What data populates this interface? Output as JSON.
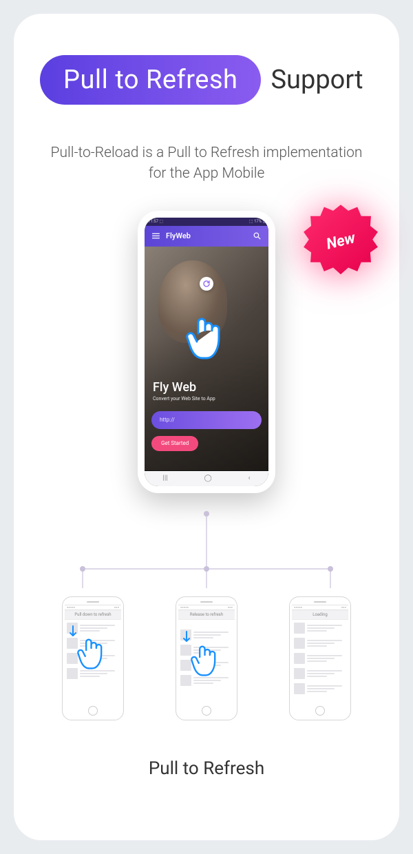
{
  "header": {
    "pill": "Pull to Refresh",
    "support": "Support"
  },
  "badge": {
    "label": "New"
  },
  "subtitle": "Pull-to-Reload is a Pull to Refresh implementation for the App Mobile",
  "main_phone": {
    "status_left": "11:57 ⬚",
    "status_right": "⬚ 17% ▯",
    "app_title": "FlyWeb",
    "hero_title": "Fly Web",
    "hero_sub": "Convert your Web Site to App",
    "url_placeholder": "http://",
    "cta": "Get Started",
    "nav": {
      "recent": "|||",
      "home": "◯",
      "back": "‹"
    }
  },
  "steps": [
    {
      "banner": "Pull down to refresh"
    },
    {
      "banner": "Release to refresh"
    },
    {
      "banner": "Loading"
    }
  ],
  "small_status": {
    "left": "●●●●●",
    "right": "●●●"
  },
  "footer": "Pull to Refresh"
}
